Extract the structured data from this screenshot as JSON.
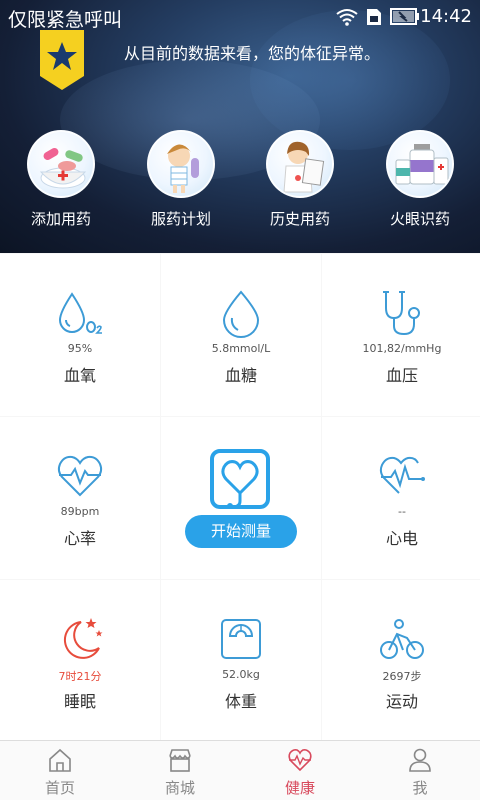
{
  "status_bar": {
    "carrier": "仅限紧急呼叫",
    "time": "14:42",
    "icons": [
      "wifi-icon",
      "sim-icon",
      "battery-icon"
    ]
  },
  "header": {
    "badge_icon": "star-badge-icon",
    "message": "从目前的数据来看，您的体征异常。"
  },
  "shortcuts": [
    {
      "label": "添加用药",
      "icon": "add-medicine-icon"
    },
    {
      "label": "服药计划",
      "icon": "medication-plan-icon"
    },
    {
      "label": "历史用药",
      "icon": "medication-history-icon"
    },
    {
      "label": "火眼识药",
      "icon": "identify-medicine-icon"
    }
  ],
  "metrics": {
    "oxygen": {
      "value": "95%",
      "name": "血氧",
      "icon": "blood-oxygen-icon"
    },
    "sugar": {
      "value": "5.8mmol/L",
      "name": "血糖",
      "icon": "blood-sugar-icon"
    },
    "pressure": {
      "value": "101,82/mmHg",
      "name": "血压",
      "icon": "stethoscope-icon"
    },
    "heart_rate": {
      "value": "89bpm",
      "name": "心率",
      "icon": "heart-rate-icon"
    },
    "ecg": {
      "value": "--",
      "name": "心电",
      "icon": "ecg-icon"
    },
    "sleep": {
      "value": "7时21分",
      "name": "睡眠",
      "icon": "moon-stars-icon"
    },
    "weight": {
      "value": "52.0kg",
      "name": "体重",
      "icon": "scale-icon"
    },
    "exercise": {
      "value": "2697步",
      "name": "运动",
      "icon": "bicycle-icon"
    }
  },
  "measure": {
    "button_label": "开始测量",
    "icon": "heart-monitor-icon"
  },
  "tabs": [
    {
      "label": "首页",
      "icon": "home-icon",
      "active": false
    },
    {
      "label": "商城",
      "icon": "store-icon",
      "active": false
    },
    {
      "label": "健康",
      "icon": "health-heart-icon",
      "active": true
    },
    {
      "label": "我",
      "icon": "user-icon",
      "active": false
    }
  ],
  "colors": {
    "accent_blue": "#2aa2e8",
    "icon_blue": "#3d9bd6",
    "active_tab": "#d84a5d",
    "sleep_red": "#e74c3c"
  }
}
